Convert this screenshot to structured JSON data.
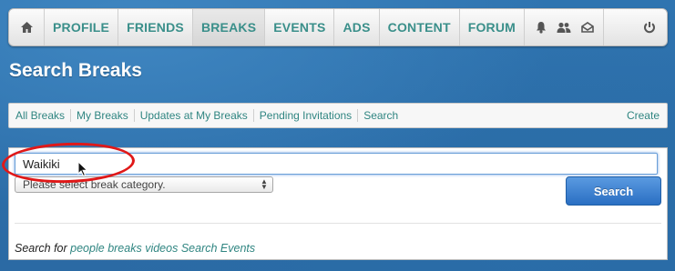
{
  "nav": {
    "items": [
      {
        "label": "PROFILE",
        "active": false
      },
      {
        "label": "FRIENDS",
        "active": false
      },
      {
        "label": "BREAKS",
        "active": true
      },
      {
        "label": "EVENTS",
        "active": false
      },
      {
        "label": "ADS",
        "active": false
      },
      {
        "label": "CONTENT",
        "active": false
      },
      {
        "label": "FORUM",
        "active": false
      }
    ],
    "icons": [
      "home-icon",
      "bell-icon",
      "users-icon",
      "envelope-icon",
      "power-icon"
    ]
  },
  "page": {
    "title": "Search Breaks"
  },
  "subnav": {
    "links": [
      "All Breaks",
      "My Breaks",
      "Updates at My Breaks",
      "Pending Invitations",
      "Search"
    ],
    "create": "Create"
  },
  "search": {
    "input_value": "Waikiki",
    "category_placeholder": "Please select break category.",
    "button_label": "Search"
  },
  "search_for": {
    "prefix": "Search for",
    "links": [
      "people",
      "breaks",
      "videos",
      "Search Events"
    ]
  },
  "colors": {
    "accent": "#3a8f8a",
    "button": "#2a6fc3",
    "annotation": "#e01818"
  }
}
